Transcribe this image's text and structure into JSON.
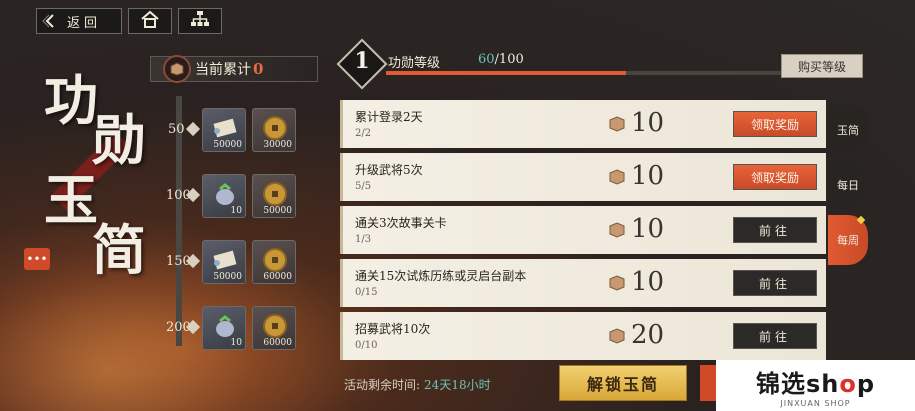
{
  "topbar": {
    "back_label": "返回"
  },
  "title_chars": [
    "功",
    "勋",
    "玉",
    "简"
  ],
  "accumulated": {
    "label": "当前累计",
    "value": "0"
  },
  "tiers": [
    {
      "level": "50",
      "rewards": [
        {
          "icon": "scroll-icon",
          "amount": "50000"
        },
        {
          "icon": "coin-icon",
          "amount": "30000"
        }
      ]
    },
    {
      "level": "100",
      "rewards": [
        {
          "icon": "pouch-icon",
          "amount": "10"
        },
        {
          "icon": "coin-icon",
          "amount": "50000"
        }
      ]
    },
    {
      "level": "150",
      "rewards": [
        {
          "icon": "scroll-icon",
          "amount": "50000"
        },
        {
          "icon": "coin-icon",
          "amount": "60000"
        }
      ]
    },
    {
      "level": "200",
      "rewards": [
        {
          "icon": "pouch-icon",
          "amount": "10"
        },
        {
          "icon": "coin-icon",
          "amount": "60000"
        }
      ]
    }
  ],
  "merit": {
    "level": "1",
    "label": "功勋等级",
    "current": "60",
    "total": "/100",
    "progress": 0.6,
    "buy_label": "购买等级"
  },
  "tasks": [
    {
      "title": "累计登录2天",
      "progress": "2/2",
      "reward": "10",
      "button": "领取奖励",
      "state": "claim"
    },
    {
      "title": "升级武将5次",
      "progress": "5/5",
      "reward": "10",
      "button": "领取奖励",
      "state": "claim"
    },
    {
      "title": "通关3次故事关卡",
      "progress": "1/3",
      "reward": "10",
      "button": "前往",
      "state": "go"
    },
    {
      "title": "通关15次试炼历练或灵启台副本",
      "progress": "0/15",
      "reward": "10",
      "button": "前往",
      "state": "go"
    },
    {
      "title": "招募武将10次",
      "progress": "0/10",
      "reward": "20",
      "button": "前往",
      "state": "go"
    }
  ],
  "side_tabs": [
    {
      "label": "玉简",
      "active": false
    },
    {
      "label": "每日",
      "active": false
    },
    {
      "label": "每周",
      "active": true
    }
  ],
  "bottom": {
    "remaining_label": "活动剩余时间:",
    "remaining_time": "24天18小时",
    "unlock_label": "解锁玉简"
  },
  "watermark": {
    "brand_main": "锦选sh",
    "brand_accent": "o",
    "brand_end": "p",
    "sub": "JINXUAN SHOP"
  },
  "colors": {
    "accent": "#e05a32",
    "teal": "#6ac4b8",
    "gold": "#f2d070"
  }
}
